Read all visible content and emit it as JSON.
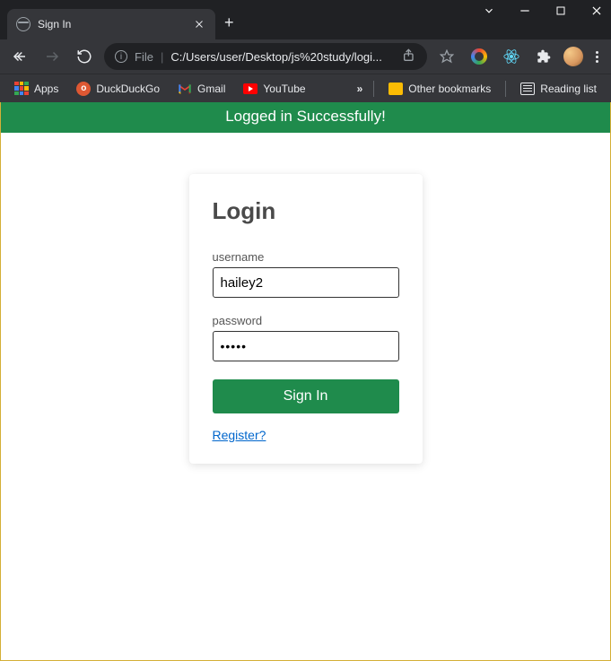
{
  "window": {
    "tab_title": "Sign In"
  },
  "address": {
    "scheme_label": "File",
    "url": "C:/Users/user/Desktop/js%20study/logi..."
  },
  "bookmarks": {
    "apps": "Apps",
    "duckduckgo": "DuckDuckGo",
    "gmail": "Gmail",
    "youtube": "YouTube",
    "other": "Other bookmarks",
    "reading_list": "Reading list"
  },
  "banner": {
    "message": "Logged in Successfully!"
  },
  "login": {
    "title": "Login",
    "username_label": "username",
    "username_value": "hailey2",
    "password_label": "password",
    "password_value": "•••••",
    "signin_label": "Sign In",
    "register_label": "Register?"
  },
  "colors": {
    "accent_green": "#1f8b4c",
    "link_blue": "#0066cc"
  }
}
